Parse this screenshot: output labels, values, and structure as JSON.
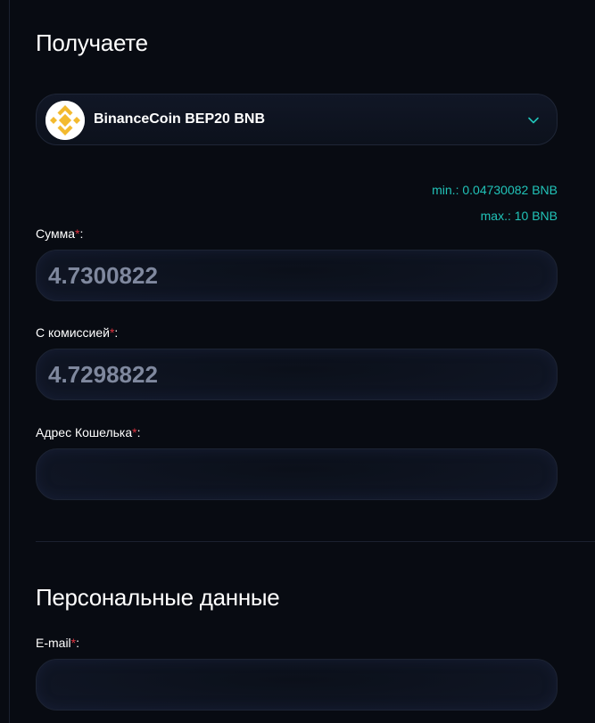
{
  "receive": {
    "title": "Получаете",
    "currency": {
      "label": "BinanceCoin BEP20 BNB",
      "icon": "bnb-coin-icon",
      "brand_color": "#f3ba2f"
    },
    "min_label": "min.: 0.04730082 BNB",
    "max_label": "max.: 10 BNB",
    "accent_color": "#21c3b8"
  },
  "fields": {
    "required_mark": "*",
    "required_color": "#e0323f",
    "amount": {
      "label": "Сумма",
      "value": "4.7300822"
    },
    "with_commission": {
      "label": "С комиссией",
      "value": "4.7298822"
    },
    "wallet_address": {
      "label": "Адрес Кошелька",
      "value": ""
    }
  },
  "personal": {
    "title": "Персональные данные",
    "email": {
      "label": "E-mail",
      "value": ""
    }
  }
}
